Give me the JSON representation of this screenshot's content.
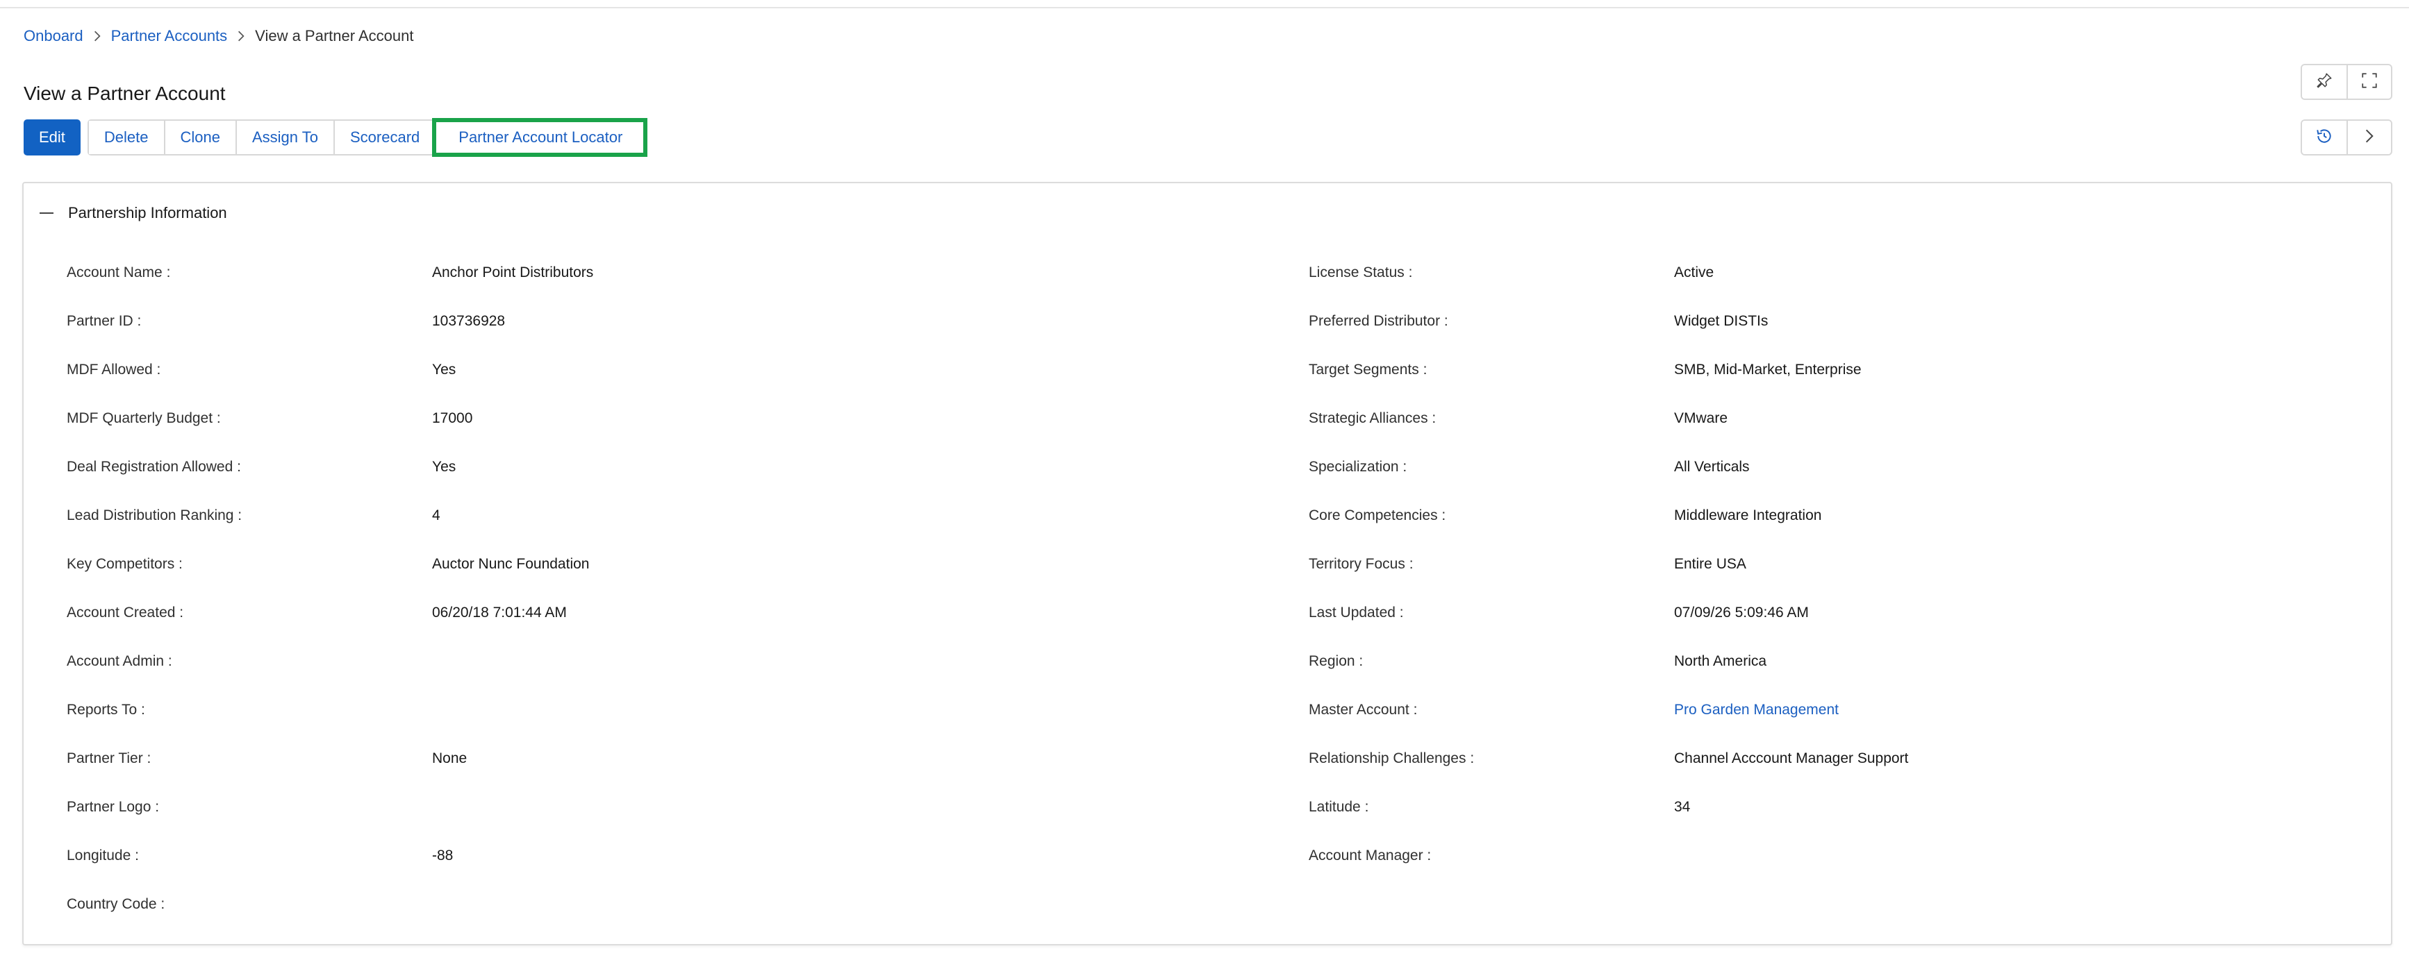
{
  "breadcrumb": {
    "items": [
      "Onboard",
      "Partner Accounts"
    ],
    "current": "View a Partner Account"
  },
  "page": {
    "title": "View a Partner Account"
  },
  "toolbar": {
    "edit": "Edit",
    "delete": "Delete",
    "clone": "Clone",
    "assign_to": "Assign To",
    "scorecard": "Scorecard",
    "locator": "Partner Account Locator"
  },
  "icons": {
    "pin": "pin-icon",
    "fullscreen": "fullscreen-icon",
    "history": "history-icon",
    "next": "chevron-right-icon",
    "collapse": "minus-icon",
    "separator": "chevron-right-icon"
  },
  "colors": {
    "primary": "#1262c3",
    "link": "#1b5fc1",
    "highlight": "#1aa34a"
  },
  "section": {
    "title": "Partnership Information",
    "left": [
      {
        "label": "Account Name :",
        "value": "Anchor Point Distributors"
      },
      {
        "label": "Partner ID :",
        "value": "103736928"
      },
      {
        "label": "MDF Allowed :",
        "value": "Yes"
      },
      {
        "label": "MDF Quarterly Budget :",
        "value": "17000"
      },
      {
        "label": "Deal Registration Allowed :",
        "value": "Yes"
      },
      {
        "label": "Lead Distribution Ranking :",
        "value": "4"
      },
      {
        "label": "Key Competitors :",
        "value": "Auctor Nunc Foundation"
      },
      {
        "label": "Account Created :",
        "value": "06/20/18 7:01:44 AM"
      },
      {
        "label": "Account Admin :",
        "value": ""
      },
      {
        "label": "Reports To :",
        "value": ""
      },
      {
        "label": "Partner Tier :",
        "value": "None"
      },
      {
        "label": "Partner Logo :",
        "value": ""
      },
      {
        "label": "Longitude :",
        "value": "-88"
      },
      {
        "label": "Country Code :",
        "value": ""
      }
    ],
    "right": [
      {
        "label": "License Status :",
        "value": "Active"
      },
      {
        "label": "Preferred Distributor :",
        "value": "Widget DISTIs"
      },
      {
        "label": "Target Segments :",
        "value": "SMB, Mid-Market, Enterprise"
      },
      {
        "label": "Strategic Alliances :",
        "value": "VMware"
      },
      {
        "label": "Specialization :",
        "value": "All Verticals"
      },
      {
        "label": "Core Competencies :",
        "value": "Middleware Integration"
      },
      {
        "label": "Territory Focus :",
        "value": "Entire USA"
      },
      {
        "label": "Last Updated :",
        "value": "07/09/26 5:09:46 AM"
      },
      {
        "label": "Region :",
        "value": "North America"
      },
      {
        "label": "Master Account :",
        "value": "Pro Garden Management"
      },
      {
        "label": "Relationship Challenges :",
        "value": "Channel Acccount Manager Support"
      },
      {
        "label": "Latitude :",
        "value": "34"
      },
      {
        "label": "Account Manager :",
        "value": ""
      }
    ]
  }
}
